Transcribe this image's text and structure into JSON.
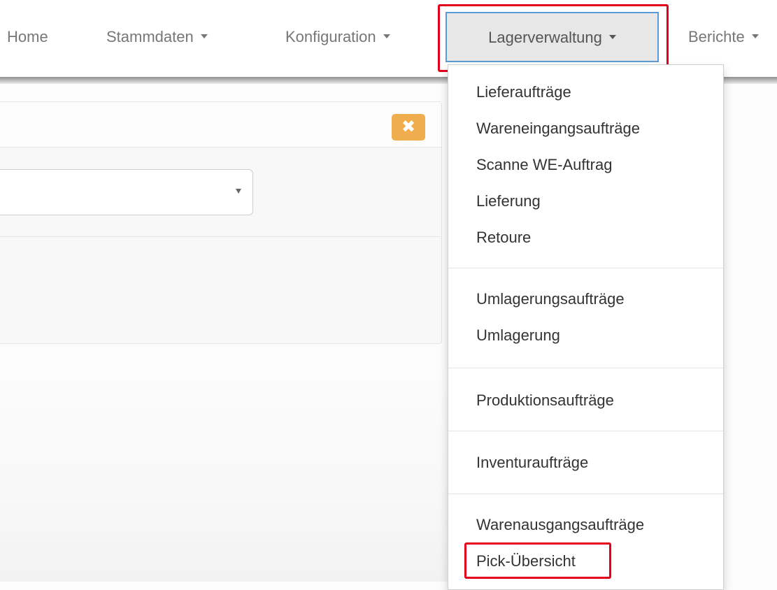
{
  "navbar": {
    "items": [
      {
        "label": "Home"
      },
      {
        "label": "Stammdaten"
      },
      {
        "label": "Konfiguration"
      },
      {
        "label": "Lagerverwaltung"
      },
      {
        "label": "Berichte"
      }
    ]
  },
  "dropdown": {
    "groups": [
      [
        "Lieferaufträge",
        "Wareneingangsaufträge",
        "Scanne WE-Auftrag",
        "Lieferung",
        "Retoure"
      ],
      [
        "Umlagerungsaufträge",
        "Umlagerung"
      ],
      [
        "Produktionsaufträge"
      ],
      [
        "Inventuraufträge"
      ],
      [
        "Warenausgangsaufträge",
        "Pick-Übersicht"
      ]
    ]
  },
  "panel": {
    "close_glyph": "✖"
  },
  "colors": {
    "highlight": "#e3001b",
    "active_border": "#5b9bd5",
    "warning_button": "#f0ad4e"
  }
}
